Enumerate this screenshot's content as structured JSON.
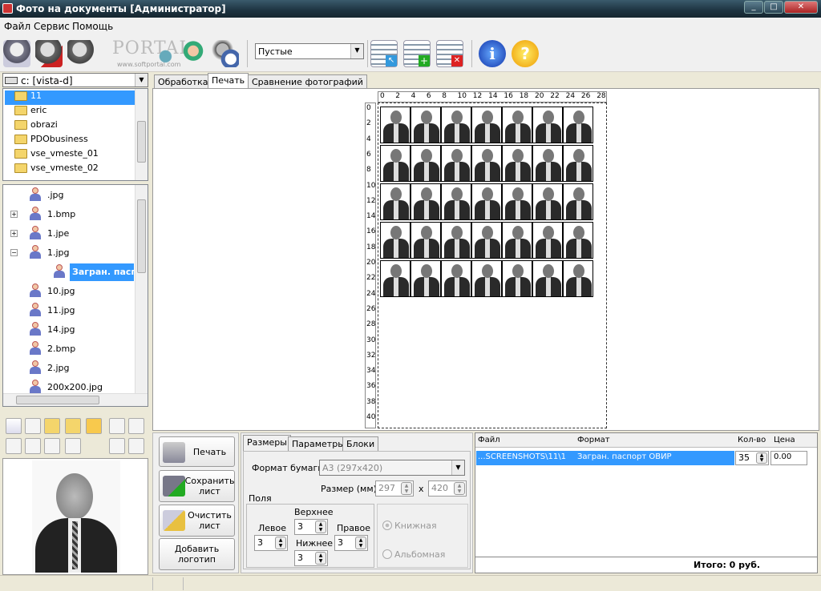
{
  "window": {
    "title": "Фото на документы  [Администратор]",
    "minimize": "_",
    "maximize": "□",
    "close": "✕"
  },
  "menu": [
    "Файл",
    "Сервис",
    "Помощь"
  ],
  "toolbar": {
    "preset_value": "Пустые",
    "watermark": "PORTAL",
    "watermark_sub": "www.softportal.com",
    "icons": [
      "camera-user-icon",
      "user-delete-icon",
      "user-settings-icon",
      "user-gear-icon",
      "user-photo-icon",
      "user-clock-icon",
      "list-select-icon",
      "list-add-icon",
      "list-delete-icon",
      "info-icon",
      "help-icon"
    ]
  },
  "drive": {
    "value": "c: [vista-d]"
  },
  "folders": [
    {
      "name": "11",
      "selected": true
    },
    {
      "name": "eric"
    },
    {
      "name": "obrazi"
    },
    {
      "name": "PDObusiness"
    },
    {
      "name": "vse_vmeste_01"
    },
    {
      "name": "vse_vmeste_02"
    }
  ],
  "files": [
    {
      "name": ".jpg"
    },
    {
      "name": "1.bmp",
      "expand": "+"
    },
    {
      "name": "1.jpe",
      "expand": "+"
    },
    {
      "name": "1.jpg",
      "expand": "−"
    },
    {
      "name": "Загран. паспорт",
      "child": true,
      "selected": true
    },
    {
      "name": "10.jpg"
    },
    {
      "name": "11.jpg"
    },
    {
      "name": "14.jpg"
    },
    {
      "name": "2.bmp"
    },
    {
      "name": "2.jpg"
    },
    {
      "name": "200x200.jpg"
    }
  ],
  "tabs": [
    "Обработка",
    "Печать",
    "Сравнение фотографий"
  ],
  "ruler": {
    "h": [
      "0",
      "2",
      "4",
      "6",
      "8",
      "10",
      "12",
      "14",
      "16",
      "18",
      "20",
      "22",
      "24",
      "26",
      "28"
    ],
    "v": [
      "0",
      "2",
      "4",
      "6",
      "8",
      "10",
      "12",
      "14",
      "16",
      "18",
      "20",
      "22",
      "24",
      "26",
      "28",
      "30",
      "32",
      "34",
      "36",
      "38",
      "40"
    ]
  },
  "sheet": {
    "rows": 5,
    "cols": 7
  },
  "actions": {
    "print": "Печать",
    "save": "Сохранить лист",
    "clear": "Очистить лист",
    "logo": "Добавить логотип"
  },
  "settings": {
    "tabs": [
      "Размеры",
      "Параметры",
      "Блоки"
    ],
    "paper_label": "Формат бумаги",
    "paper_value": "A3 (297x420)",
    "size_label": "Размер (мм):",
    "width": "297",
    "x": "x",
    "height": "420",
    "margins_label": "Поля",
    "top_label": "Верхнее",
    "top": "3",
    "left_label": "Левое",
    "left": "3",
    "right_label": "Правое",
    "right": "3",
    "bottom_label": "Нижнее",
    "bottom": "3",
    "portrait": "Книжная",
    "landscape": "Альбомная"
  },
  "orders": {
    "headers": [
      "Файл",
      "Формат",
      "Кол-во",
      "Цена"
    ],
    "rows": [
      {
        "file": "...SCREENSHOTS\\11\\1",
        "format": "Загран. паспорт ОВИР",
        "qty": "35",
        "price": "0.00"
      }
    ],
    "total": "Итого: 0 руб."
  }
}
